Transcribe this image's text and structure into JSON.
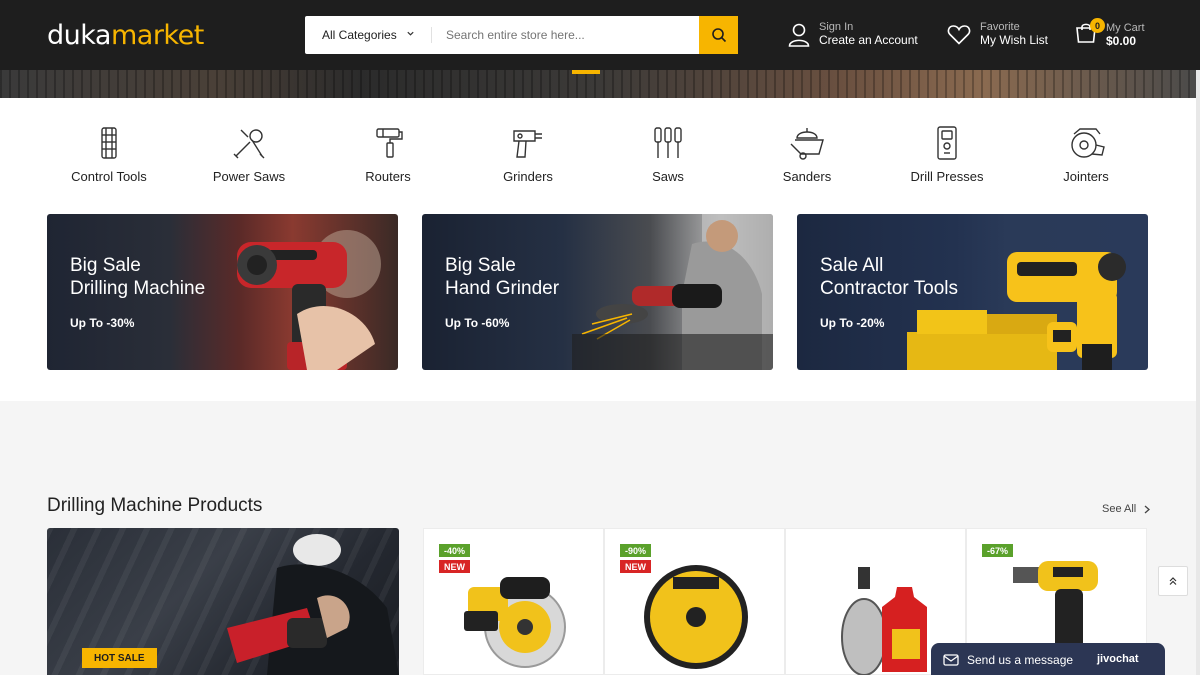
{
  "header": {
    "logo_part1": "duka",
    "logo_part2": "market",
    "category_select": "All Categories",
    "search_placeholder": "Search entire store here...",
    "account": {
      "small": "Sign In",
      "big": "Create an Account"
    },
    "wishlist": {
      "small": "Favorite",
      "big": "My Wish List"
    },
    "cart": {
      "count": "0",
      "small": "My Cart",
      "big": "$0.00"
    }
  },
  "categories": [
    {
      "label": "Control Tools",
      "icon": "control-tools-icon"
    },
    {
      "label": "Power Saws",
      "icon": "power-saws-icon"
    },
    {
      "label": "Routers",
      "icon": "routers-icon"
    },
    {
      "label": "Grinders",
      "icon": "grinders-icon"
    },
    {
      "label": "Saws",
      "icon": "saws-icon"
    },
    {
      "label": "Sanders",
      "icon": "sanders-icon"
    },
    {
      "label": "Drill Presses",
      "icon": "drill-presses-icon"
    },
    {
      "label": "Jointers",
      "icon": "jointers-icon"
    }
  ],
  "banners": [
    {
      "line1": "Big Sale",
      "line2": "Drilling Machine",
      "offer": "Up To -30%"
    },
    {
      "line1": "Big Sale",
      "line2": "Hand Grinder",
      "offer": "Up To -60%"
    },
    {
      "line1": "Sale All",
      "line2": "Contractor Tools",
      "offer": "Up To -20%"
    }
  ],
  "products_section": {
    "title": "Drilling Machine Products",
    "see_all": "See All",
    "promo_label": "HOT SALE",
    "products": [
      {
        "discount": "-40%",
        "new": "NEW"
      },
      {
        "discount": "-90%",
        "new": "NEW"
      },
      {
        "discount": "",
        "new": ""
      },
      {
        "discount": "-67%",
        "new": ""
      }
    ]
  },
  "chat": {
    "label": "Send us a message",
    "brand": "jivochat"
  },
  "colors": {
    "accent": "#f7b500",
    "header_bg": "#1e1e1e",
    "discount": "#5aa12b",
    "new": "#d82525",
    "chat_bg": "#2c3654"
  }
}
